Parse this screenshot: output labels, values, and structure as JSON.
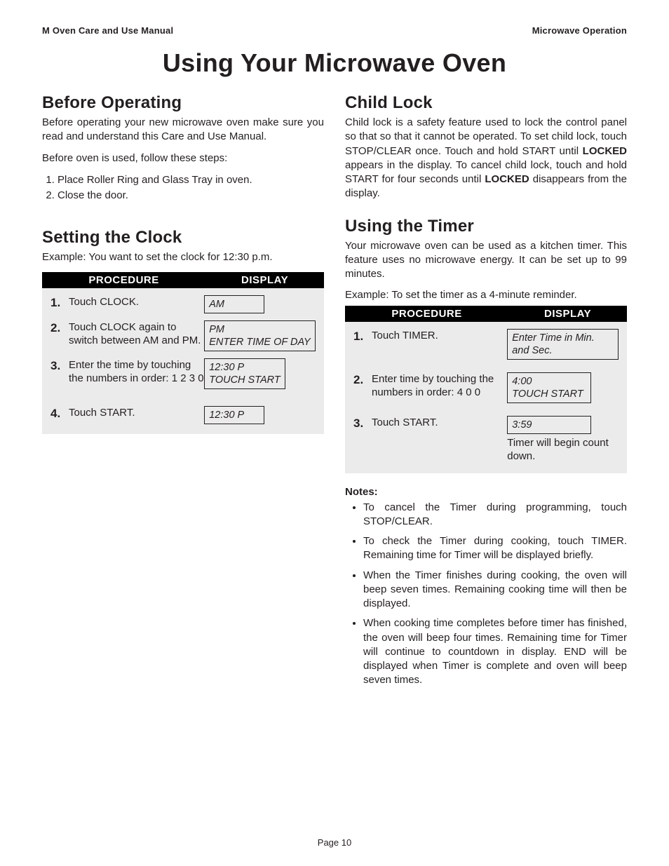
{
  "header": {
    "left": "M Oven Care and Use Manual",
    "right": "Microwave Operation"
  },
  "title": "Using Your Microwave Oven",
  "left_col": {
    "before": {
      "heading": "Before Operating",
      "p1": "Before operating your new microwave oven make sure you read and understand this Care and Use Manual.",
      "p2": "Before oven is used, follow these steps:",
      "steps": [
        "Place Roller Ring and Glass Tray in oven.",
        "Close the door."
      ]
    },
    "clock": {
      "heading": "Setting the Clock",
      "example": "Example: You want to set the clock for 12:30 p.m.",
      "table_headers": {
        "proc": "PROCEDURE",
        "disp": "DISPLAY"
      },
      "rows": [
        {
          "num": "1.",
          "text": "Touch CLOCK.",
          "display": "AM"
        },
        {
          "num": "2.",
          "text": "Touch CLOCK again to switch between AM and PM.",
          "display": "PM\nENTER TIME OF DAY"
        },
        {
          "num": "3.",
          "text": "Enter the time by touching the numbers in order:  1  2  3  0",
          "display": "12:30 P\nTOUCH START"
        },
        {
          "num": "4.",
          "text": "Touch START.",
          "display": "12:30 P"
        }
      ]
    }
  },
  "right_col": {
    "childlock": {
      "heading": "Child Lock",
      "p_pre": "Child lock is a safety feature used to lock the control panel so that so that it cannot be operated. To set child lock, touch STOP/CLEAR once. Touch and hold START until ",
      "bold1": "LOCKED",
      "p_mid": " appears in the display. To cancel child lock, touch and hold START for four seconds until ",
      "bold2": "LOCKED",
      "p_post": " disappears from the display."
    },
    "timer": {
      "heading": "Using the Timer",
      "p1": "Your microwave oven can be used as a kitchen timer. This feature uses no microwave energy. It can be set up to 99 minutes.",
      "example": "Example: To set the timer as a 4-minute reminder.",
      "table_headers": {
        "proc": "PROCEDURE",
        "disp": "DISPLAY"
      },
      "rows": [
        {
          "num": "1.",
          "text": "Touch TIMER.",
          "display": "Enter Time in Min. and Sec."
        },
        {
          "num": "2.",
          "text": "Enter time by touching the numbers in order:  4  0  0",
          "display": "4:00\nTOUCH START"
        },
        {
          "num": "3.",
          "text": "Touch START.",
          "display": "3:59",
          "note": "Timer will begin count down."
        }
      ],
      "notes_label": "Notes:",
      "notes": [
        "To cancel the Timer during programming, touch STOP/CLEAR.",
        "To check the Timer during cooking, touch TIMER. Remaining time for Timer will be displayed briefly.",
        "When the Timer finishes during cooking, the oven will beep seven times. Remaining cooking time will then be displayed.",
        {
          "pre": "When cooking time completes before timer has finished, the oven will beep four times. Remaining time for Timer will continue to countdown in display. ",
          "bold": "END",
          "post": " will be displayed when Timer is complete and oven will beep seven times."
        }
      ]
    }
  },
  "footer": "Page 10"
}
